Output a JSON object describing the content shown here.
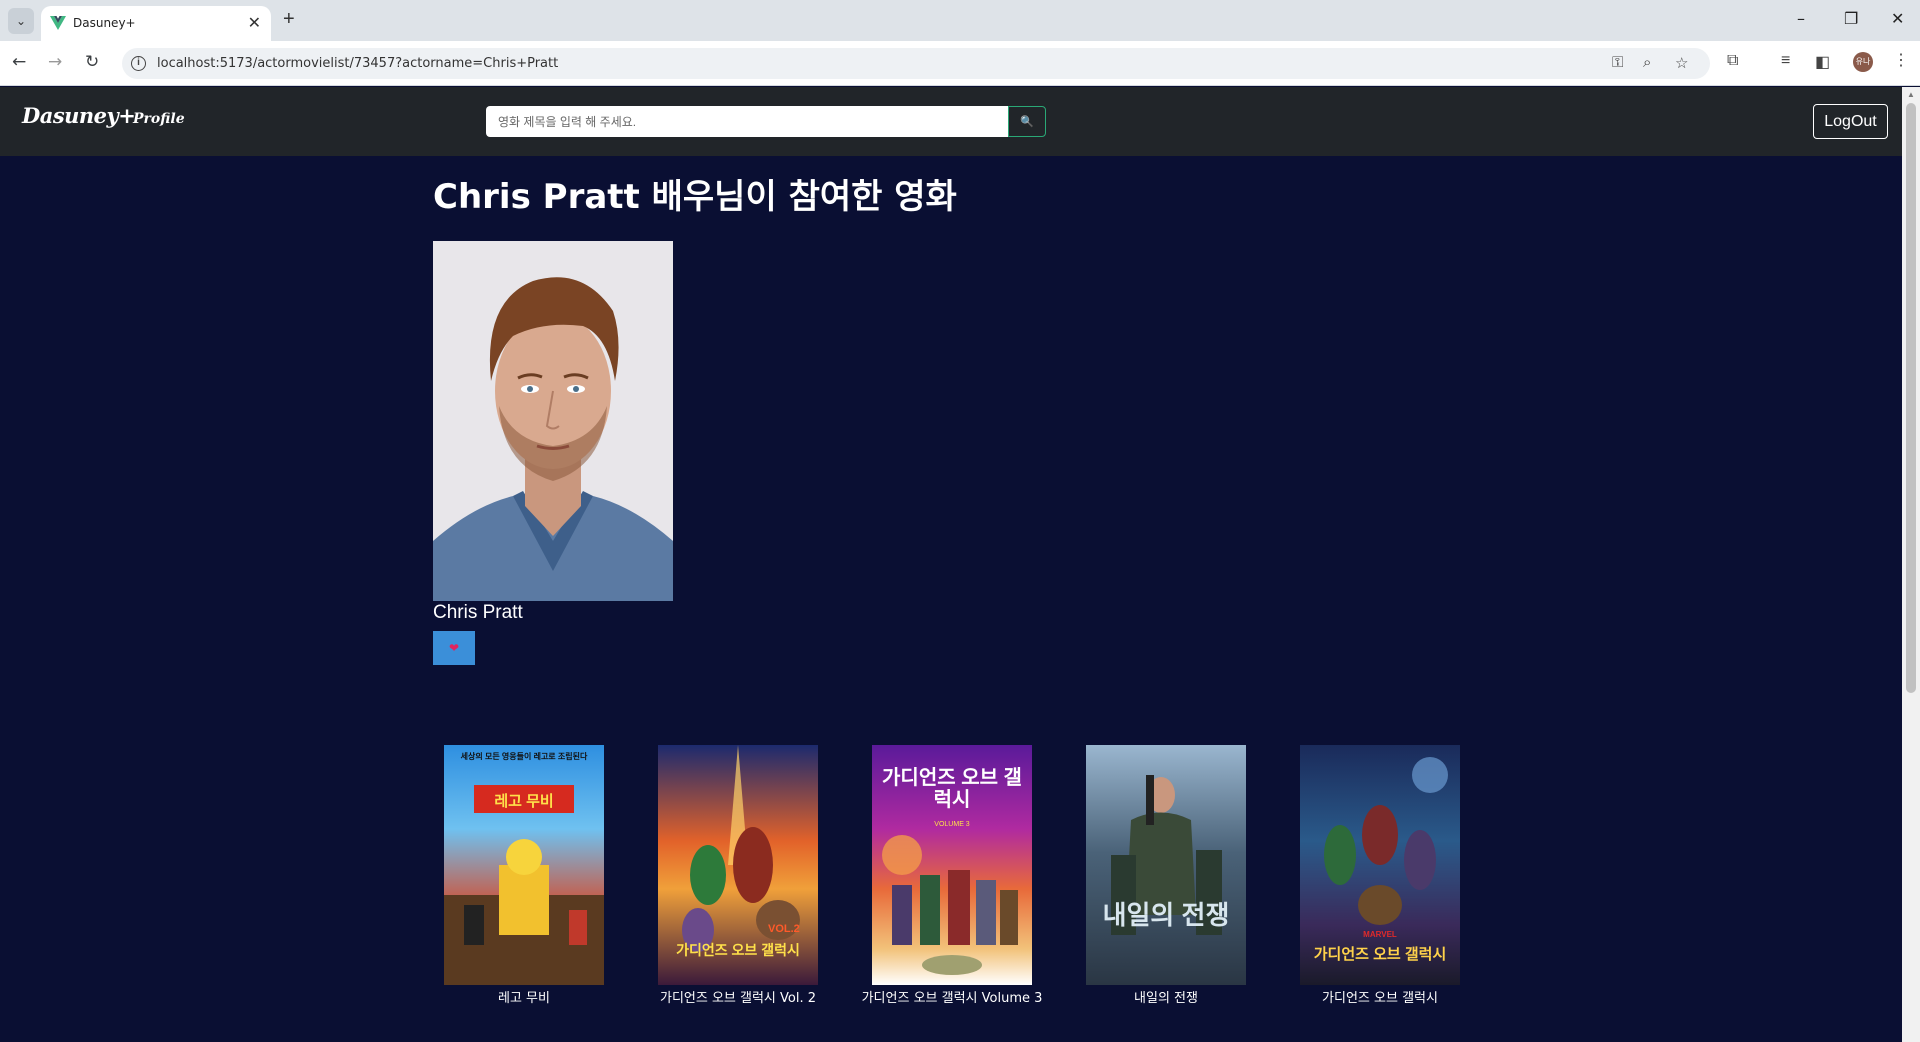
{
  "browser": {
    "tab_title": "Dasuney+",
    "url": "localhost:5173/actormovielist/73457?actorname=Chris+Pratt",
    "new_tab_icon": "+",
    "tab_close_icon": "✕",
    "minimize_icon": "–",
    "restore_icon": "❐",
    "close_icon": "✕",
    "avatar_text": "유나"
  },
  "navbar": {
    "logo": "Dasuney+",
    "profile_link": "Profile",
    "search_placeholder": "영화 제목을 입력 해 주세요.",
    "search_button_icon": "🔍",
    "logout_label": "LogOut"
  },
  "main": {
    "title": "Chris Pratt 배우님이 참여한 영화",
    "actor_name": "Chris Pratt",
    "like_icon": "❤"
  },
  "movies": [
    {
      "title": "레고 무비",
      "poster_text": "레고 무비",
      "poster_top": "세상의 모든 영웅들이 레고로 조립된다"
    },
    {
      "title": "가디언즈 오브 갤럭시 Vol. 2",
      "poster_text": "가디언즈 오브 갤럭시",
      "poster_top": "VOL.2"
    },
    {
      "title": "가디언즈 오브 갤럭시 Volume 3",
      "poster_text": "가디언즈 오브 갤럭시",
      "poster_top": "VOLUME 3"
    },
    {
      "title": "내일의 전쟁",
      "poster_text": "내일의 전쟁",
      "poster_top": ""
    },
    {
      "title": "가디언즈 오브 갤럭시",
      "poster_text": "가디언즈 오브 갤럭시",
      "poster_top": "MARVEL"
    }
  ],
  "colors": {
    "page_bg": "#0a0f33",
    "navbar_bg": "#212529",
    "like_button": "#3b8fd9",
    "search_button_border": "#2aa876"
  }
}
